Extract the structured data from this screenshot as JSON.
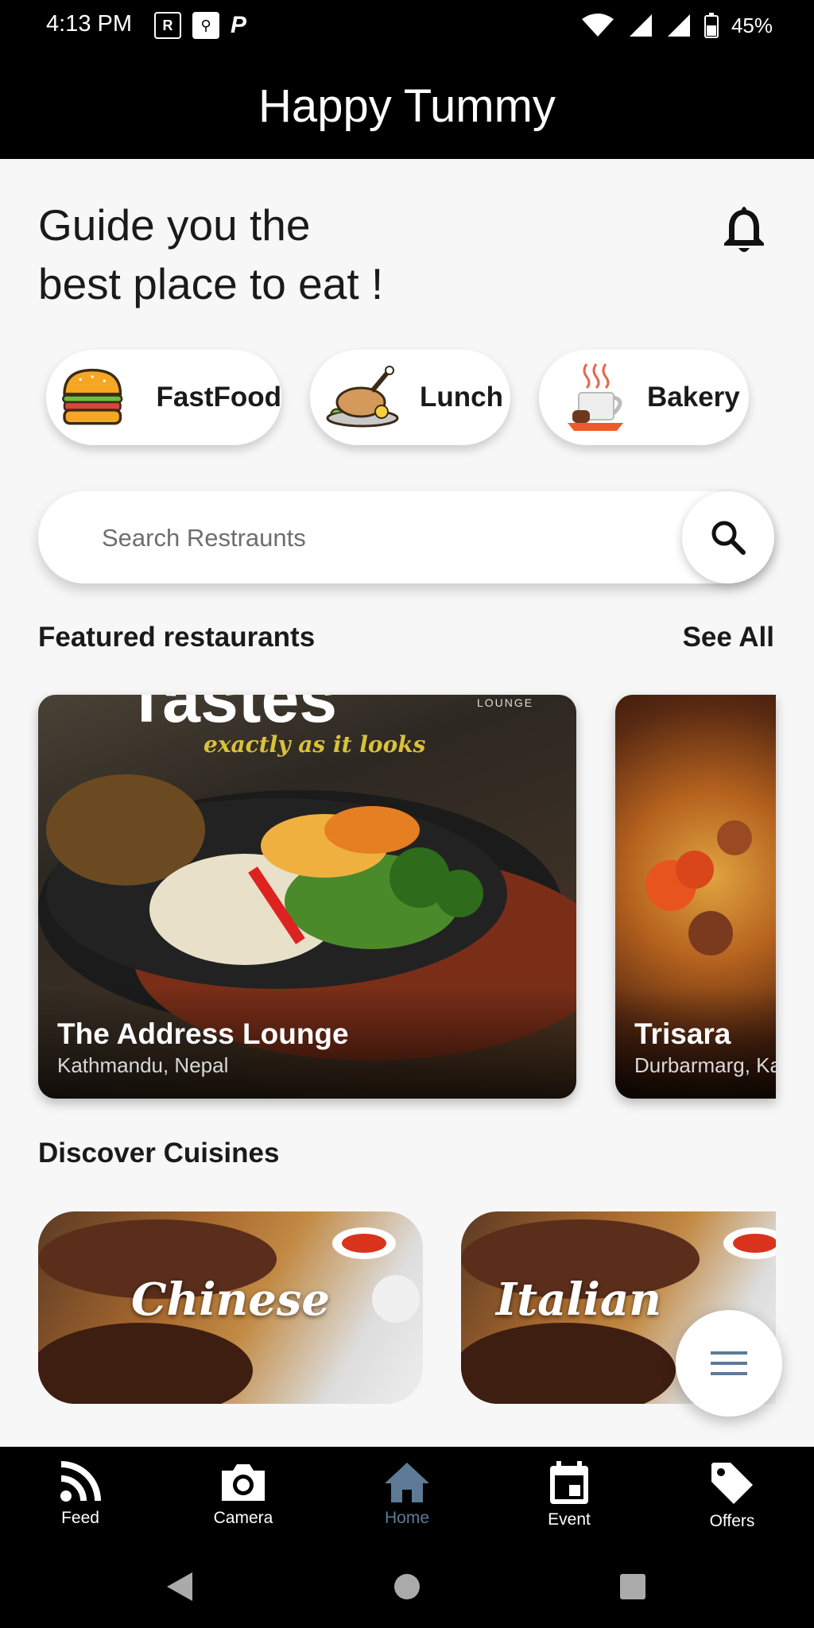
{
  "status_bar": {
    "time": "4:13 PM",
    "battery": "45%",
    "left_icons": [
      "rr-icon",
      "usb-icon",
      "parking-icon"
    ],
    "right_icons": [
      "wifi-icon",
      "signal-icon",
      "signal-icon",
      "battery-icon"
    ]
  },
  "app_bar": {
    "title": "Happy Tummy"
  },
  "headline": {
    "line1": "Guide you the",
    "line2": "best place to eat !"
  },
  "categories": [
    {
      "label": "FastFood",
      "icon": "burger-icon"
    },
    {
      "label": "Lunch",
      "icon": "roast-chicken-icon"
    },
    {
      "label": "Bakery",
      "icon": "coffee-cup-icon"
    }
  ],
  "search": {
    "placeholder": "Search Restraunts"
  },
  "featured": {
    "title": "Featured restaurants",
    "see_all": "See All",
    "items": [
      {
        "name": "The Address Lounge",
        "location": "Kathmandu, Nepal",
        "banner_text": "Tastes",
        "banner_sub": "exactly as it looks",
        "banner_brand": "LOUNGE"
      },
      {
        "name": "Trisara",
        "location": "Durbarmarg, Kat"
      }
    ]
  },
  "cuisines": {
    "title": "Discover Cuisines",
    "items": [
      {
        "label": "Chinese"
      },
      {
        "label": "Italian"
      }
    ]
  },
  "bottom_nav": {
    "items": [
      {
        "label": "Feed",
        "icon": "rss-icon",
        "active": false
      },
      {
        "label": "Camera",
        "icon": "camera-icon",
        "active": false
      },
      {
        "label": "Home",
        "icon": "home-icon",
        "active": true
      },
      {
        "label": "Event",
        "icon": "calendar-icon",
        "active": false
      },
      {
        "label": "Offers",
        "icon": "tag-icon",
        "active": false
      }
    ]
  },
  "colors": {
    "bar": "#000000",
    "background": "#f7f7f7",
    "active_nav": "#5d7a96"
  }
}
